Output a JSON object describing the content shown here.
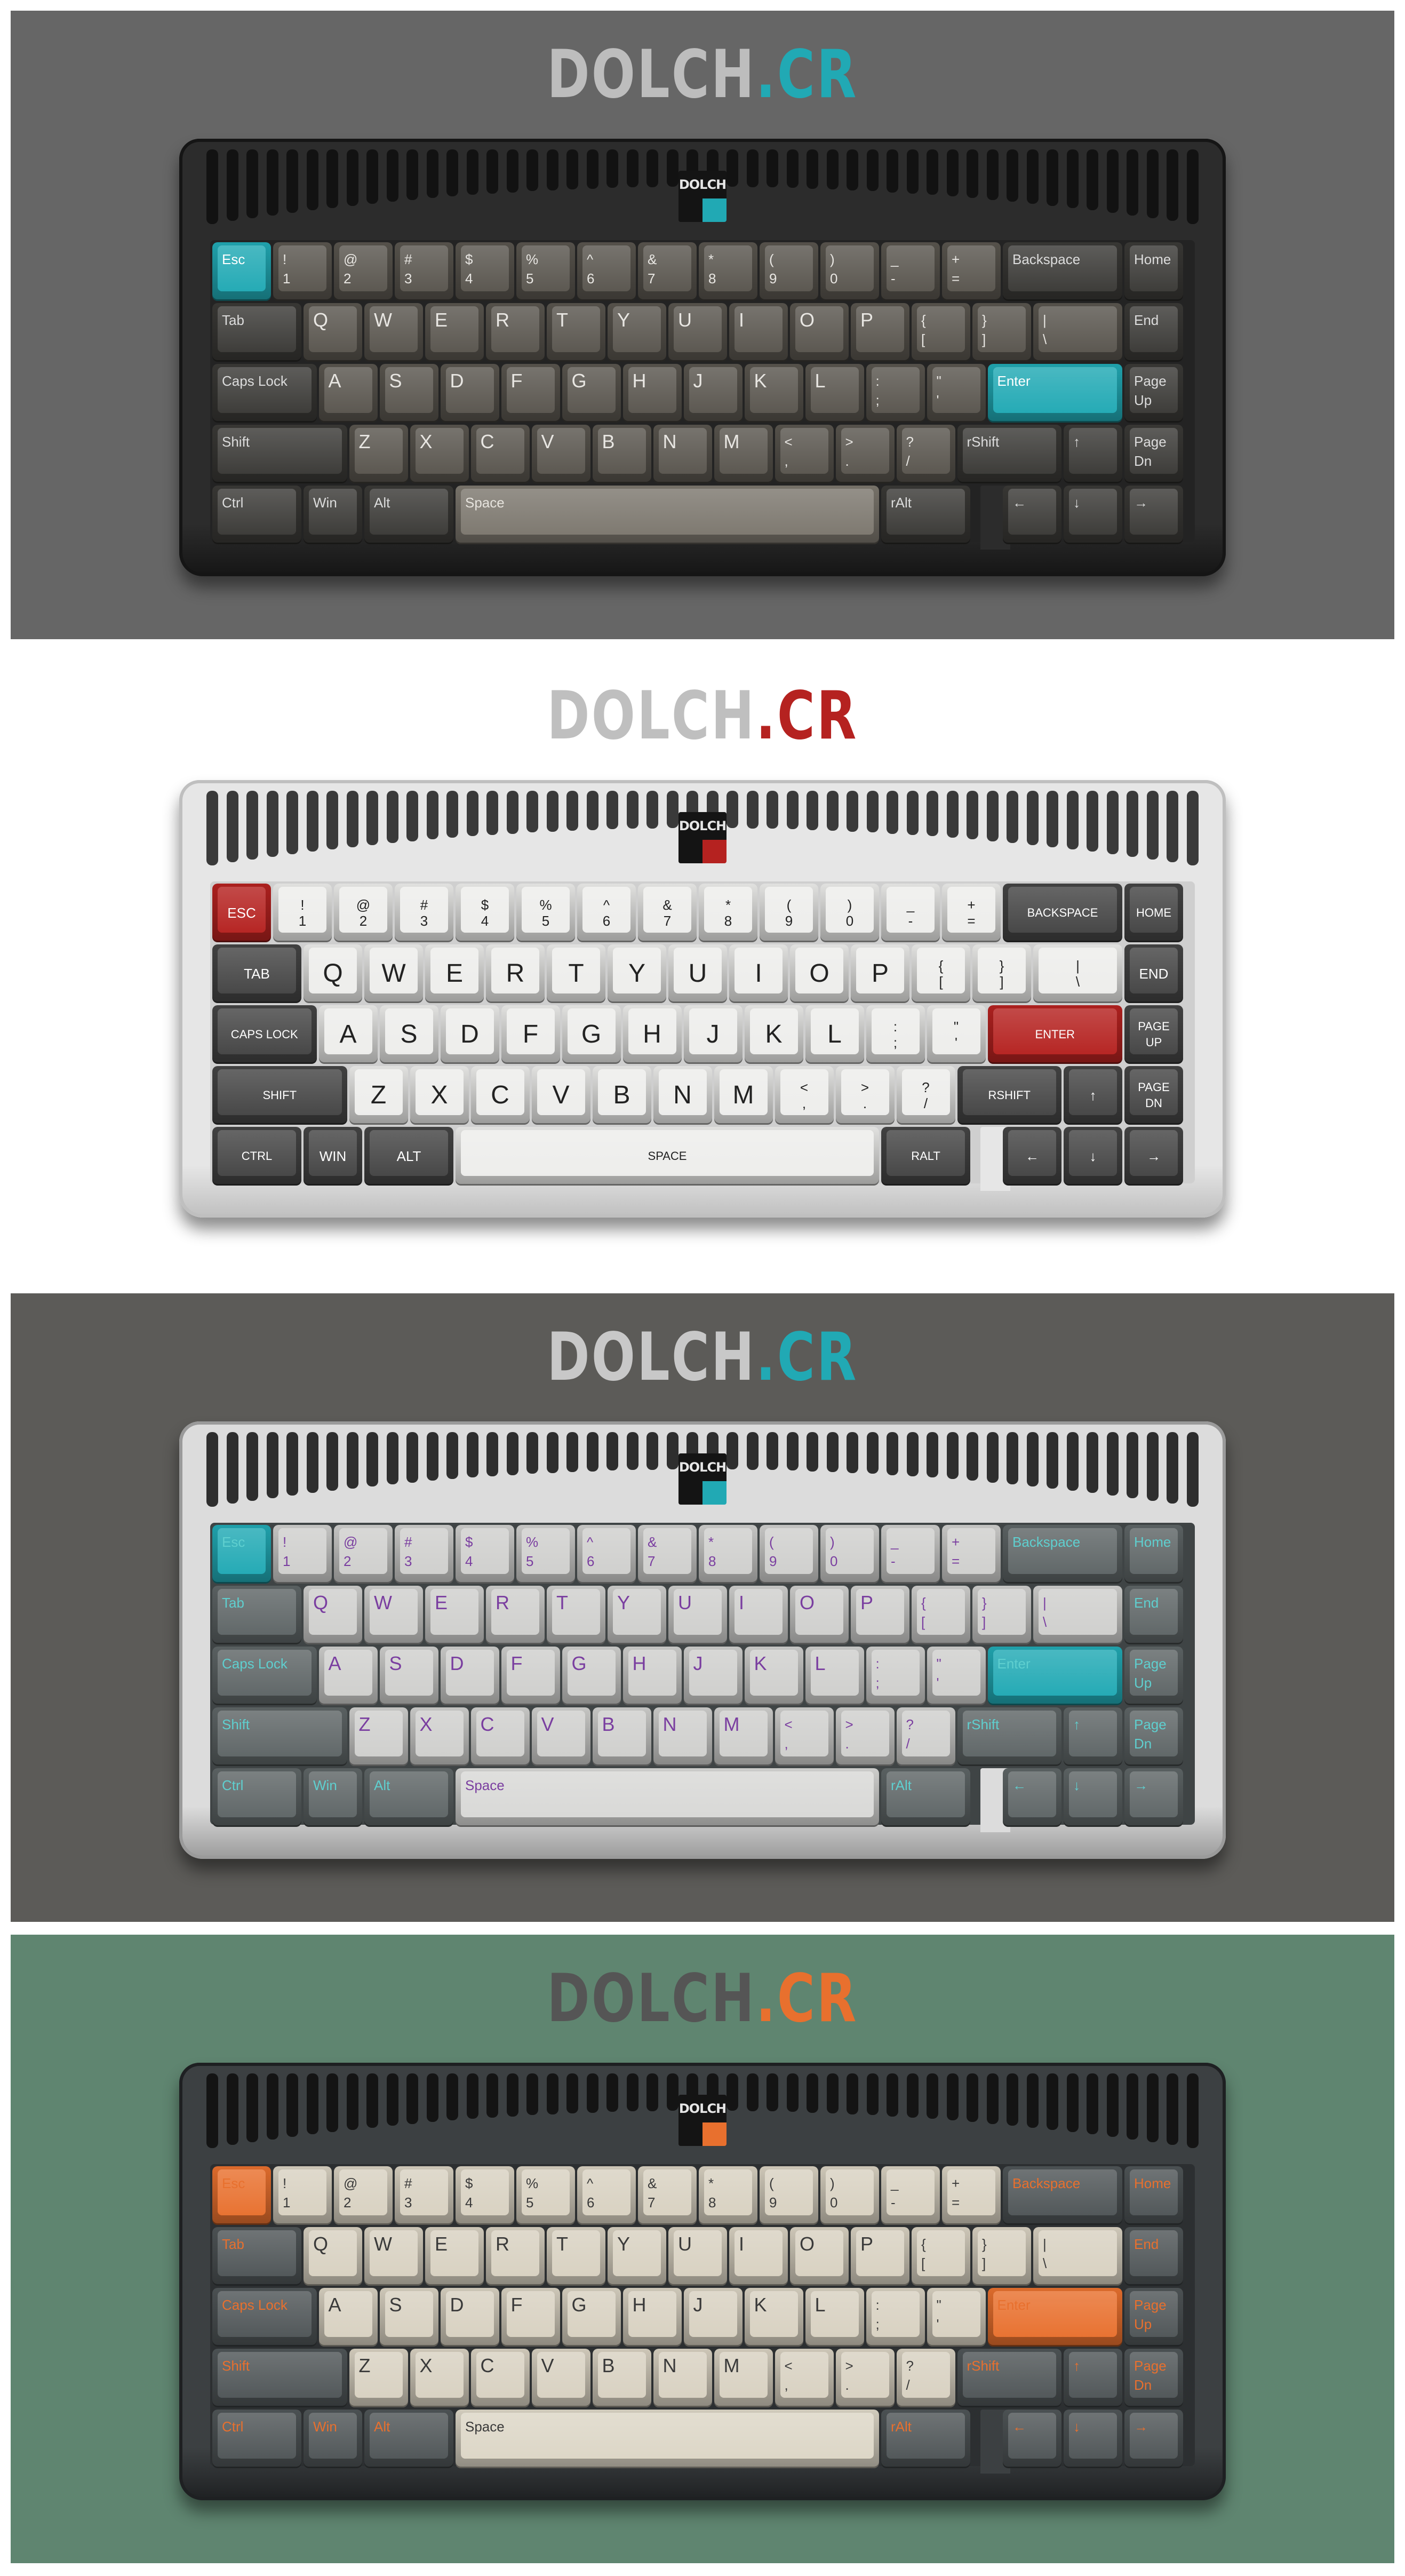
{
  "brand": {
    "name": "DOLCH",
    "suffix": ".CR"
  },
  "badge_text": "DOLCH",
  "themes": [
    {
      "id": "dolch-teal-dark",
      "panel_bg": "#666666",
      "case_color": "#2c2c2c",
      "case_edge": "#151515",
      "plate_color": "#232323",
      "vent_color": "#121212",
      "brand_color": "#bdbdbd",
      "accent": "#21a9b4",
      "mod_color": "#3a3936",
      "alpha_color": "#59554e",
      "space_color": "#7c776e",
      "legend_mod": "#dcdcdc",
      "legend_alpha": "#e8e6e2",
      "legend_accent": "#ffffff",
      "uppercase": false,
      "centered": false
    },
    {
      "id": "dolch-red-white",
      "panel_bg": "#ffffff",
      "case_color": "#e6e6e6",
      "case_edge": "#bfbfbf",
      "plate_color": "#cfcfcf",
      "vent_color": "#3a3a3a",
      "brand_color": "#bfbfbf",
      "accent": "#b52220",
      "mod_color": "#444444",
      "alpha_color": "#ededeb",
      "space_color": "#ededeb",
      "legend_mod": "#ffffff",
      "legend_alpha": "#222222",
      "legend_accent": "#ffffff",
      "uppercase": true,
      "centered": true
    },
    {
      "id": "dolch-purple-grey",
      "panel_bg": "#5c5b58",
      "case_color": "#dcdcdc",
      "case_edge": "#9a9a9a",
      "plate_color": "#3f4445",
      "vent_color": "#2e2e2e",
      "brand_color": "#c8c8c8",
      "accent": "#21a9b4",
      "mod_color": "#5e6566",
      "alpha_color": "#cfcfcd",
      "space_color": "#d8d8d6",
      "legend_mod": "#5fcfcf",
      "legend_alpha": "#7a3ea0",
      "legend_accent": "#5fcfcf",
      "uppercase": false,
      "centered": false
    },
    {
      "id": "dolch-orange-beige",
      "panel_bg": "#5f8570",
      "case_color": "#3c4042",
      "case_edge": "#1e2022",
      "plate_color": "#2c2f31",
      "vent_color": "#141414",
      "brand_color": "#555555",
      "accent": "#e8702e",
      "mod_color": "#4f5557",
      "alpha_color": "#d8d1c1",
      "space_color": "#dcd6c6",
      "legend_mod": "#e8702e",
      "legend_alpha": "#3a3a3a",
      "legend_accent": "#e8702e",
      "uppercase": false,
      "centered": false
    }
  ],
  "keys": [
    {
      "row": 0,
      "x": 0,
      "w": 1,
      "label": "Esc",
      "kind": "accent"
    },
    {
      "row": 0,
      "x": 1,
      "w": 1,
      "label": "!\n1",
      "kind": "alpha"
    },
    {
      "row": 0,
      "x": 2,
      "w": 1,
      "label": "@\n2",
      "kind": "alpha"
    },
    {
      "row": 0,
      "x": 3,
      "w": 1,
      "label": "#\n3",
      "kind": "alpha"
    },
    {
      "row": 0,
      "x": 4,
      "w": 1,
      "label": "$\n4",
      "kind": "alpha"
    },
    {
      "row": 0,
      "x": 5,
      "w": 1,
      "label": "%\n5",
      "kind": "alpha"
    },
    {
      "row": 0,
      "x": 6,
      "w": 1,
      "label": "^\n6",
      "kind": "alpha"
    },
    {
      "row": 0,
      "x": 7,
      "w": 1,
      "label": "&\n7",
      "kind": "alpha"
    },
    {
      "row": 0,
      "x": 8,
      "w": 1,
      "label": "*\n8",
      "kind": "alpha"
    },
    {
      "row": 0,
      "x": 9,
      "w": 1,
      "label": "(\n9",
      "kind": "alpha"
    },
    {
      "row": 0,
      "x": 10,
      "w": 1,
      "label": ")\n0",
      "kind": "alpha"
    },
    {
      "row": 0,
      "x": 11,
      "w": 1,
      "label": "_\n-",
      "kind": "alpha"
    },
    {
      "row": 0,
      "x": 12,
      "w": 1,
      "label": "+\n=",
      "kind": "alpha"
    },
    {
      "row": 0,
      "x": 13,
      "w": 2,
      "label": "Backspace",
      "kind": "mod"
    },
    {
      "row": 0,
      "x": 15,
      "w": 1,
      "label": "Home",
      "kind": "mod"
    },
    {
      "row": 1,
      "x": 0,
      "w": 1.5,
      "label": "Tab",
      "kind": "mod"
    },
    {
      "row": 1,
      "x": 1.5,
      "w": 1,
      "label": "Q",
      "kind": "alpha"
    },
    {
      "row": 1,
      "x": 2.5,
      "w": 1,
      "label": "W",
      "kind": "alpha"
    },
    {
      "row": 1,
      "x": 3.5,
      "w": 1,
      "label": "E",
      "kind": "alpha"
    },
    {
      "row": 1,
      "x": 4.5,
      "w": 1,
      "label": "R",
      "kind": "alpha"
    },
    {
      "row": 1,
      "x": 5.5,
      "w": 1,
      "label": "T",
      "kind": "alpha"
    },
    {
      "row": 1,
      "x": 6.5,
      "w": 1,
      "label": "Y",
      "kind": "alpha"
    },
    {
      "row": 1,
      "x": 7.5,
      "w": 1,
      "label": "U",
      "kind": "alpha"
    },
    {
      "row": 1,
      "x": 8.5,
      "w": 1,
      "label": "I",
      "kind": "alpha"
    },
    {
      "row": 1,
      "x": 9.5,
      "w": 1,
      "label": "O",
      "kind": "alpha"
    },
    {
      "row": 1,
      "x": 10.5,
      "w": 1,
      "label": "P",
      "kind": "alpha"
    },
    {
      "row": 1,
      "x": 11.5,
      "w": 1,
      "label": "{\n[",
      "kind": "alpha"
    },
    {
      "row": 1,
      "x": 12.5,
      "w": 1,
      "label": "}\n]",
      "kind": "alpha"
    },
    {
      "row": 1,
      "x": 13.5,
      "w": 1.5,
      "label": "|\n\\",
      "kind": "alpha"
    },
    {
      "row": 1,
      "x": 15,
      "w": 1,
      "label": "End",
      "kind": "mod"
    },
    {
      "row": 2,
      "x": 0,
      "w": 1.75,
      "label": "Caps Lock",
      "kind": "mod"
    },
    {
      "row": 2,
      "x": 1.75,
      "w": 1,
      "label": "A",
      "kind": "alpha"
    },
    {
      "row": 2,
      "x": 2.75,
      "w": 1,
      "label": "S",
      "kind": "alpha"
    },
    {
      "row": 2,
      "x": 3.75,
      "w": 1,
      "label": "D",
      "kind": "alpha"
    },
    {
      "row": 2,
      "x": 4.75,
      "w": 1,
      "label": "F",
      "kind": "alpha"
    },
    {
      "row": 2,
      "x": 5.75,
      "w": 1,
      "label": "G",
      "kind": "alpha"
    },
    {
      "row": 2,
      "x": 6.75,
      "w": 1,
      "label": "H",
      "kind": "alpha"
    },
    {
      "row": 2,
      "x": 7.75,
      "w": 1,
      "label": "J",
      "kind": "alpha"
    },
    {
      "row": 2,
      "x": 8.75,
      "w": 1,
      "label": "K",
      "kind": "alpha"
    },
    {
      "row": 2,
      "x": 9.75,
      "w": 1,
      "label": "L",
      "kind": "alpha"
    },
    {
      "row": 2,
      "x": 10.75,
      "w": 1,
      "label": ":\n;",
      "kind": "alpha"
    },
    {
      "row": 2,
      "x": 11.75,
      "w": 1,
      "label": "\"\n'",
      "kind": "alpha"
    },
    {
      "row": 2,
      "x": 12.75,
      "w": 2.25,
      "label": "Enter",
      "kind": "accent"
    },
    {
      "row": 2,
      "x": 15,
      "w": 1,
      "label": "Page\nUp",
      "kind": "mod"
    },
    {
      "row": 3,
      "x": 0,
      "w": 2.25,
      "label": "Shift",
      "kind": "mod"
    },
    {
      "row": 3,
      "x": 2.25,
      "w": 1,
      "label": "Z",
      "kind": "alpha"
    },
    {
      "row": 3,
      "x": 3.25,
      "w": 1,
      "label": "X",
      "kind": "alpha"
    },
    {
      "row": 3,
      "x": 4.25,
      "w": 1,
      "label": "C",
      "kind": "alpha"
    },
    {
      "row": 3,
      "x": 5.25,
      "w": 1,
      "label": "V",
      "kind": "alpha"
    },
    {
      "row": 3,
      "x": 6.25,
      "w": 1,
      "label": "B",
      "kind": "alpha"
    },
    {
      "row": 3,
      "x": 7.25,
      "w": 1,
      "label": "N",
      "kind": "alpha"
    },
    {
      "row": 3,
      "x": 8.25,
      "w": 1,
      "label": "M",
      "kind": "alpha"
    },
    {
      "row": 3,
      "x": 9.25,
      "w": 1,
      "label": "<\n,",
      "kind": "alpha"
    },
    {
      "row": 3,
      "x": 10.25,
      "w": 1,
      "label": ">\n.",
      "kind": "alpha"
    },
    {
      "row": 3,
      "x": 11.25,
      "w": 1,
      "label": "?\n/",
      "kind": "alpha"
    },
    {
      "row": 3,
      "x": 12.25,
      "w": 1.75,
      "label": "rShift",
      "kind": "mod"
    },
    {
      "row": 3,
      "x": 14,
      "w": 1,
      "label": "↑",
      "kind": "mod"
    },
    {
      "row": 3,
      "x": 15,
      "w": 1,
      "label": "Page\nDn",
      "kind": "mod"
    },
    {
      "row": 4,
      "x": 0,
      "w": 1.5,
      "label": "Ctrl",
      "kind": "mod"
    },
    {
      "row": 4,
      "x": 1.5,
      "w": 1,
      "label": "Win",
      "kind": "mod"
    },
    {
      "row": 4,
      "x": 2.5,
      "w": 1.5,
      "label": "Alt",
      "kind": "mod"
    },
    {
      "row": 4,
      "x": 4,
      "w": 7,
      "label": "Space",
      "kind": "space"
    },
    {
      "row": 4,
      "x": 11,
      "w": 1.5,
      "label": "rAlt",
      "kind": "mod"
    },
    {
      "row": 4,
      "x": 13,
      "w": 1,
      "label": "←",
      "kind": "mod"
    },
    {
      "row": 4,
      "x": 14,
      "w": 1,
      "label": "↓",
      "kind": "mod"
    },
    {
      "row": 4,
      "x": 15,
      "w": 1,
      "label": "→",
      "kind": "mod"
    }
  ]
}
